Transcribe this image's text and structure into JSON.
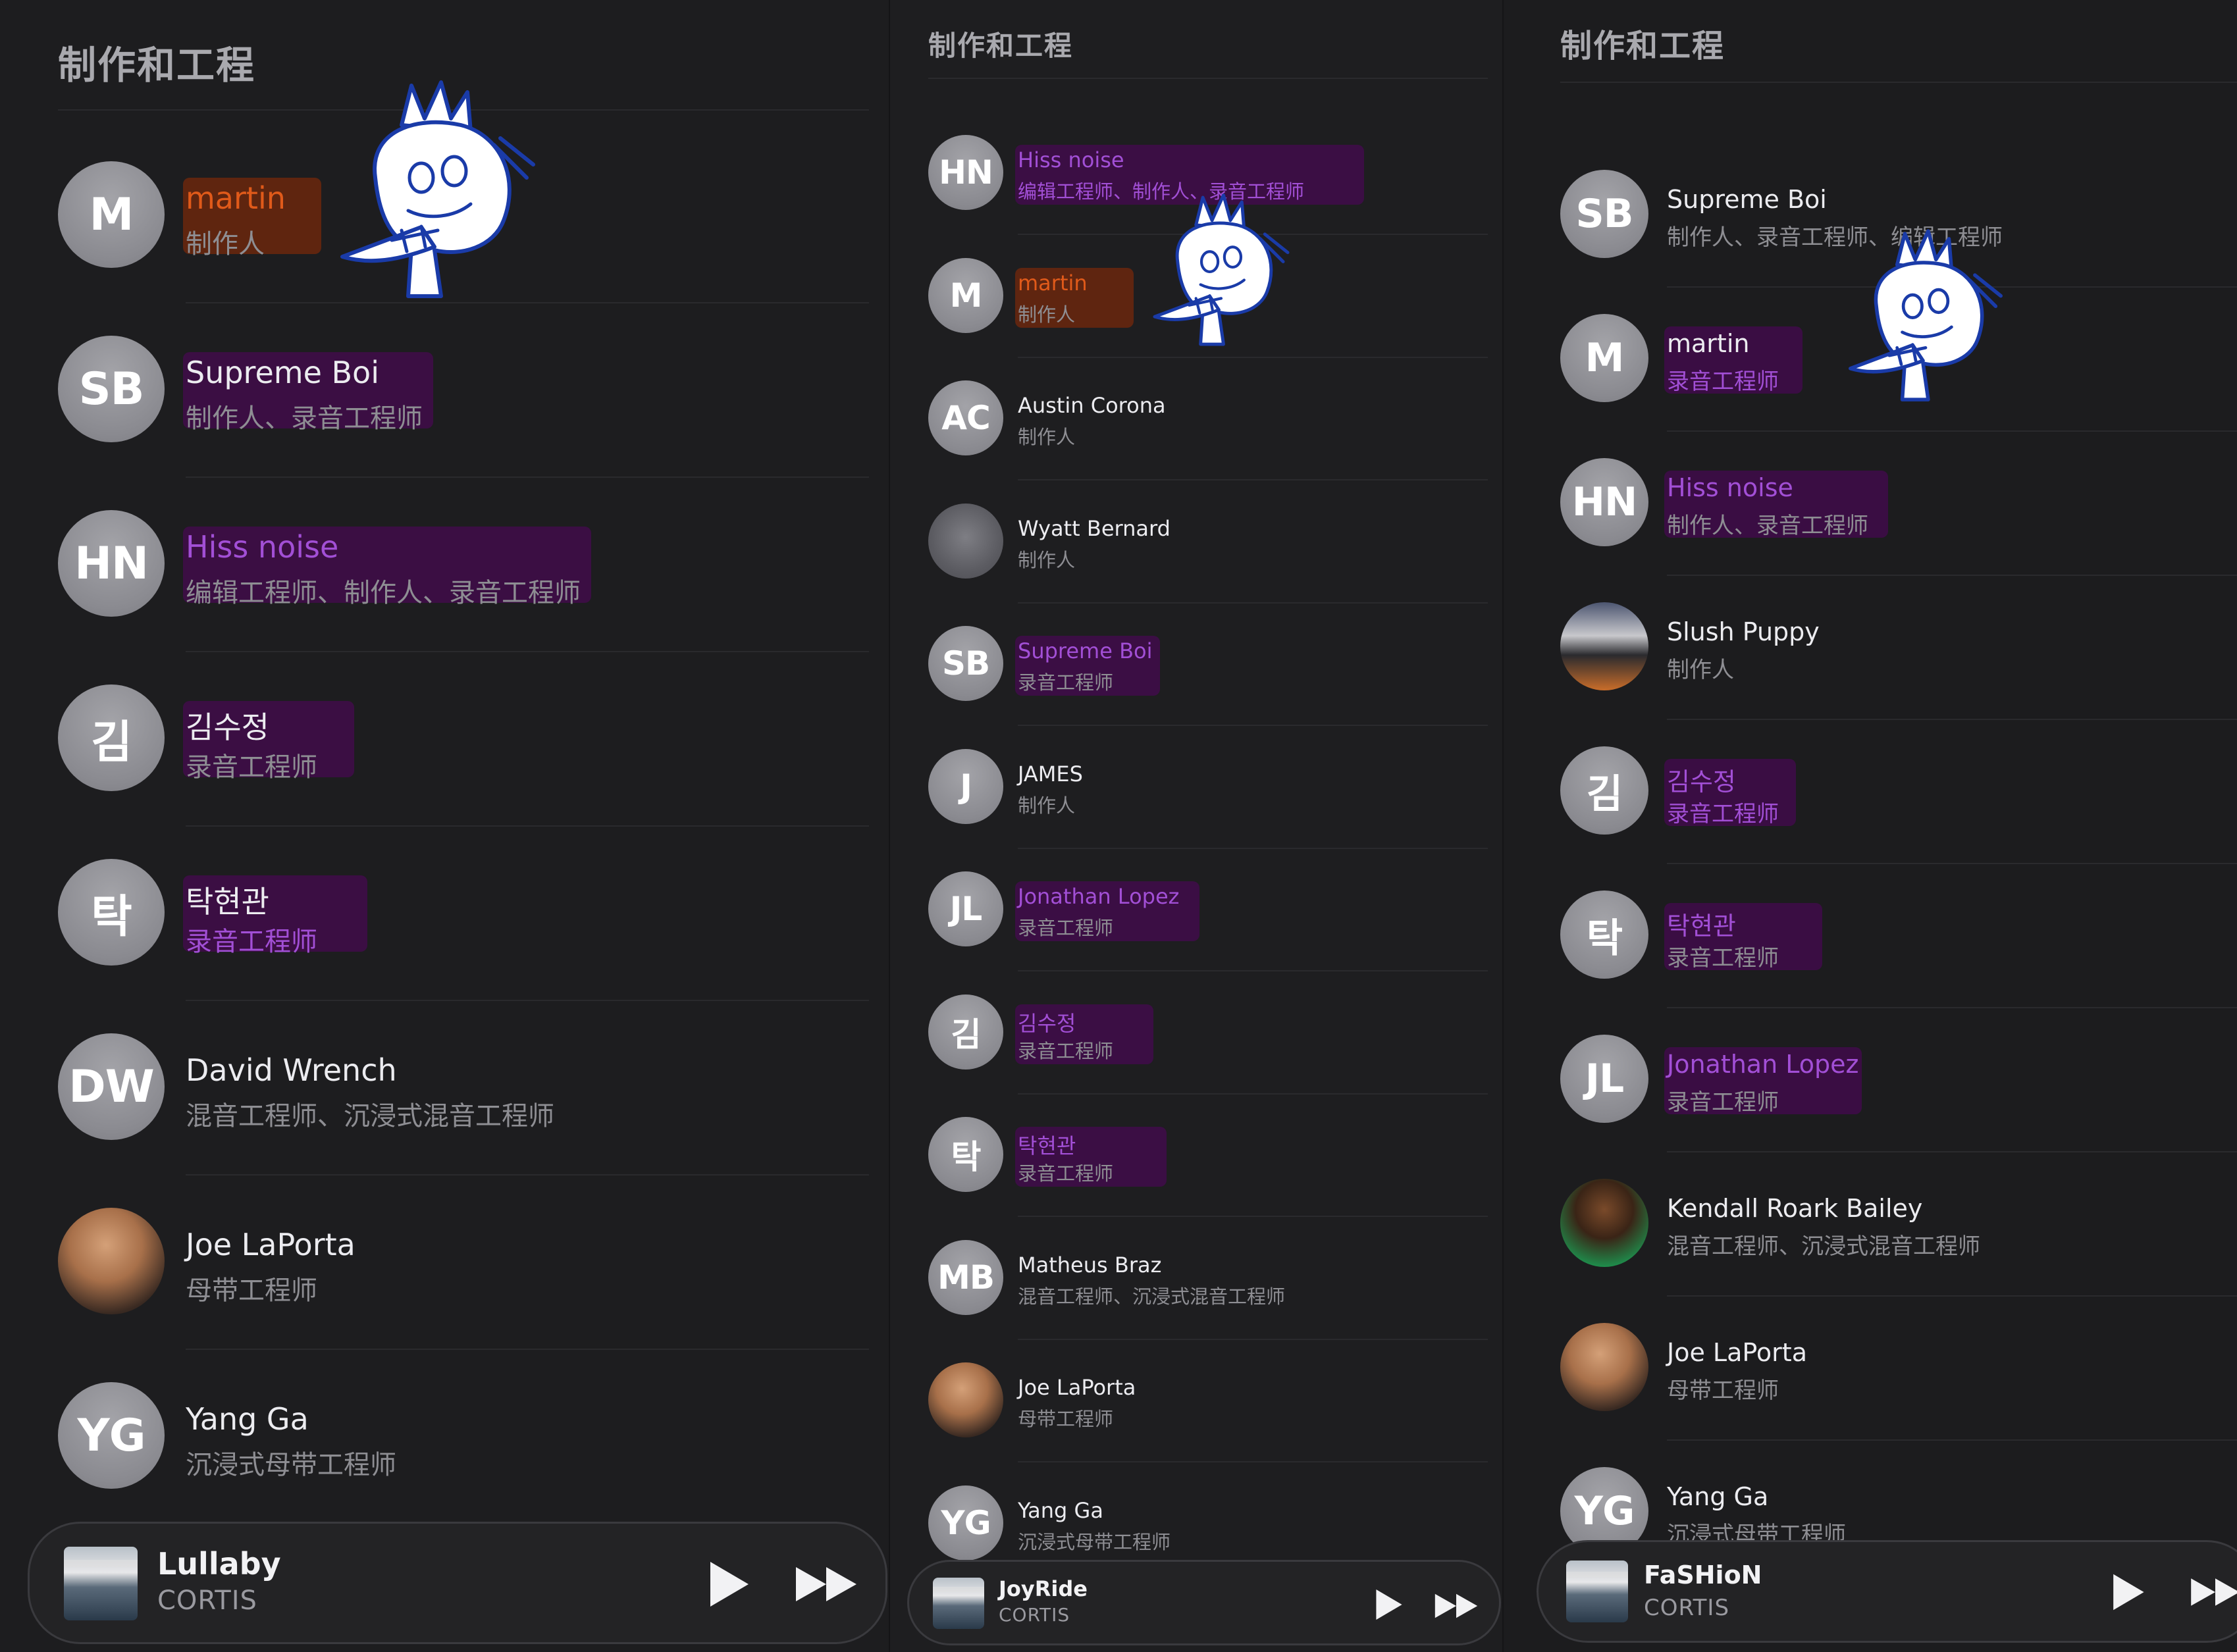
{
  "section_title": "制作和工程",
  "panels": [
    {
      "credits": [
        {
          "initials": "M",
          "name": "martin",
          "role": "制作人",
          "name_color": "orange",
          "highlight": "orange"
        },
        {
          "initials": "SB",
          "name": "Supreme Boi",
          "role": "制作人、录音工程师",
          "highlight": "purple"
        },
        {
          "initials": "HN",
          "name": "Hiss noise",
          "role": "编辑工程师、制作人、录音工程师",
          "name_color": "purple",
          "highlight": "purple"
        },
        {
          "initials": "김",
          "name": "김수정",
          "role": "录音工程师",
          "highlight": "purple"
        },
        {
          "initials": "탁",
          "name": "탁현관",
          "role": "录音工程师",
          "role_color": "purple",
          "highlight": "purple"
        },
        {
          "initials": "DW",
          "name": "David Wrench",
          "role": "混音工程师、沉浸式混音工程师"
        },
        {
          "initials": "",
          "photo": "joe",
          "name": "Joe LaPorta",
          "role": "母带工程师"
        },
        {
          "initials": "YG",
          "name": "Yang Ga",
          "role": "沉浸式母带工程师"
        }
      ],
      "now_playing": {
        "title": "Lullaby",
        "artist": "CORTIS"
      }
    },
    {
      "credits": [
        {
          "initials": "HN",
          "name": "Hiss noise",
          "role": "编辑工程师、制作人、录音工程师",
          "name_color": "purple",
          "role_color": "purple",
          "highlight": "purple"
        },
        {
          "initials": "M",
          "name": "martin",
          "role": "制作人",
          "name_color": "orange",
          "highlight": "orange"
        },
        {
          "initials": "AC",
          "name": "Austin Corona",
          "role": "制作人"
        },
        {
          "initials": "",
          "photo": "wyatt",
          "name": "Wyatt Bernard",
          "role": "制作人"
        },
        {
          "initials": "SB",
          "name": "Supreme Boi",
          "role": "录音工程师",
          "name_color": "purple",
          "highlight": "purple"
        },
        {
          "initials": "J",
          "name": "JAMES",
          "role": "制作人"
        },
        {
          "initials": "JL",
          "name": "Jonathan Lopez",
          "role": "录音工程师",
          "name_color": "purple",
          "highlight": "purple"
        },
        {
          "initials": "김",
          "name": "김수정",
          "role": "录音工程师",
          "name_color": "purple",
          "highlight": "purple"
        },
        {
          "initials": "탁",
          "name": "탁현관",
          "role": "录音工程师",
          "name_color": "purple",
          "highlight": "purple"
        },
        {
          "initials": "MB",
          "name": "Matheus Braz",
          "role": "混音工程师、沉浸式混音工程师"
        },
        {
          "initials": "",
          "photo": "joe",
          "name": "Joe LaPorta",
          "role": "母带工程师"
        },
        {
          "initials": "YG",
          "name": "Yang Ga",
          "role": "沉浸式母带工程师"
        }
      ],
      "now_playing": {
        "title": "JoyRide",
        "artist": "CORTIS"
      }
    },
    {
      "credits": [
        {
          "initials": "SB",
          "name": "Supreme Boi",
          "role": "制作人、录音工程师、编辑工程师"
        },
        {
          "initials": "M",
          "name": "martin",
          "role": "录音工程师",
          "role_color": "purple",
          "highlight": "purple"
        },
        {
          "initials": "HN",
          "name": "Hiss noise",
          "role": "制作人、录音工程师",
          "name_color": "purple",
          "highlight": "purple"
        },
        {
          "initials": "",
          "photo": "slush",
          "name": "Slush Puppy",
          "role": "制作人"
        },
        {
          "initials": "김",
          "name": "김수정",
          "role": "录音工程师",
          "name_color": "purple",
          "role_color": "purple",
          "highlight": "purple"
        },
        {
          "initials": "탁",
          "name": "탁현관",
          "role": "录音工程师",
          "name_color": "purple",
          "highlight": "purple"
        },
        {
          "initials": "JL",
          "name": "Jonathan Lopez",
          "role": "录音工程师",
          "name_color": "purple",
          "highlight": "purple"
        },
        {
          "initials": "",
          "photo": "kendall",
          "name": "Kendall Roark Bailey",
          "role": "混音工程师、沉浸式混音工程师"
        },
        {
          "initials": "",
          "photo": "joe",
          "name": "Joe LaPorta",
          "role": "母带工程师"
        },
        {
          "initials": "YG",
          "name": "Yang Ga",
          "role": "沉浸式母带工程师"
        }
      ],
      "now_playing": {
        "title": "FaSHioN",
        "artist": "CORTIS"
      }
    }
  ],
  "icons": {
    "play": "play-icon",
    "skip": "fast-forward-icon",
    "sticker": "crown-doodle-sticker"
  },
  "colors": {
    "background": "#1c1c1e",
    "highlight_purple": "#a24fd6",
    "highlight_orange": "#e05a1a",
    "secondary_text": "#8e8e93"
  }
}
